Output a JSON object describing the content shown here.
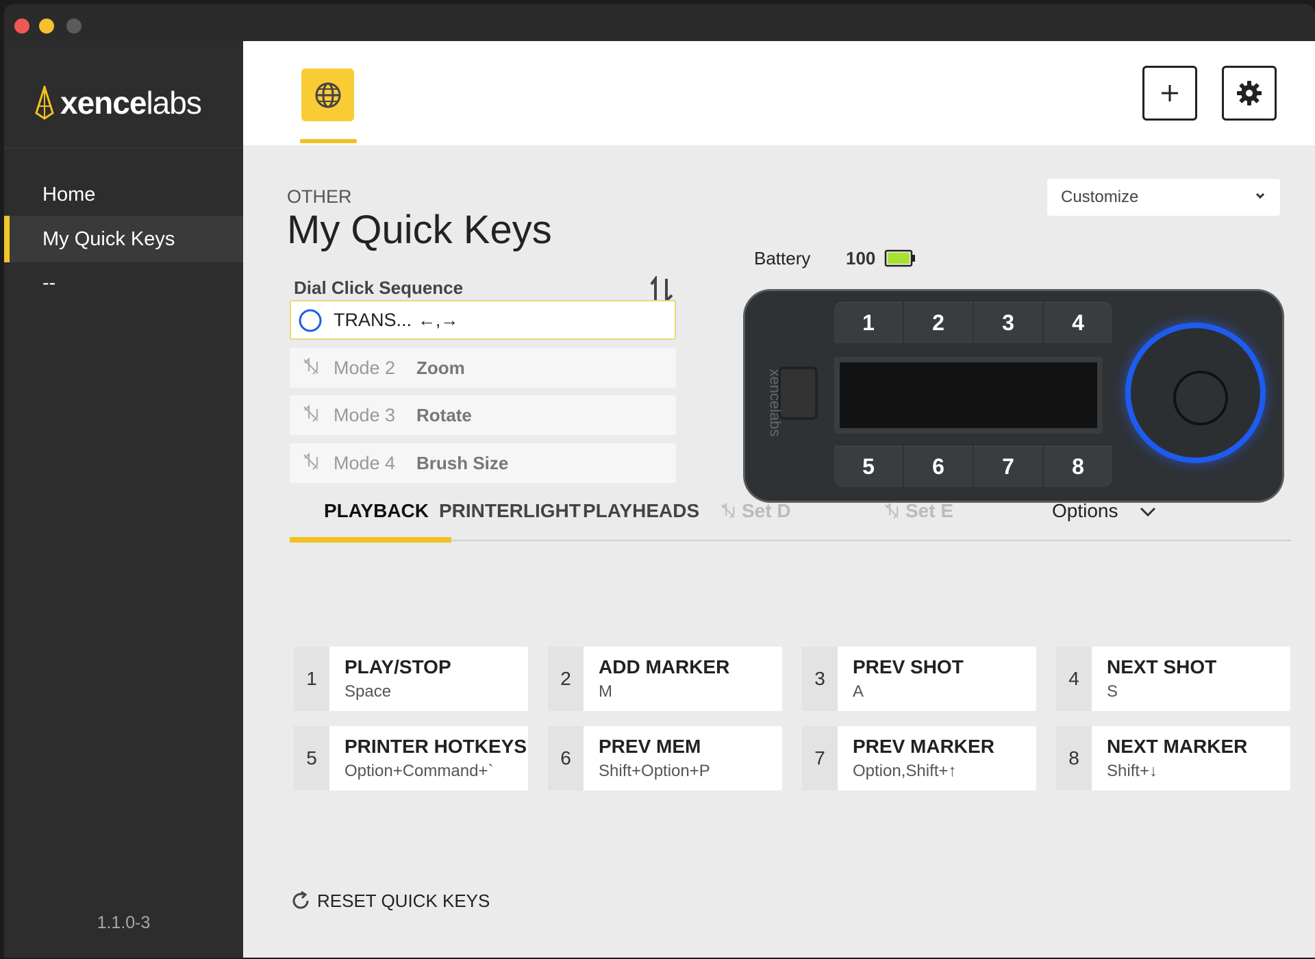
{
  "brand": {
    "name_bold": "xence",
    "name_light": "labs"
  },
  "sidebar": {
    "items": [
      {
        "label": "Home"
      },
      {
        "label": "My Quick Keys"
      },
      {
        "label": "--"
      }
    ],
    "version": "1.1.0-3"
  },
  "header": {
    "profile_icon": "globe-icon",
    "add_icon": "plus-icon",
    "settings_icon": "gear-icon"
  },
  "page": {
    "breadcrumb": "OTHER",
    "title": "My Quick Keys"
  },
  "customize": {
    "value": "Customize"
  },
  "battery": {
    "label": "Battery",
    "value": "100",
    "color": "#a6e22e"
  },
  "dial": {
    "label": "Dial Click Sequence",
    "modes": [
      {
        "name": "TRANS...",
        "value": "←,→"
      },
      {
        "name": "Mode 2",
        "value": "Zoom"
      },
      {
        "name": "Mode 3",
        "value": "Rotate"
      },
      {
        "name": "Mode 4",
        "value": "Brush Size"
      }
    ]
  },
  "device": {
    "keys": [
      "1",
      "2",
      "3",
      "4",
      "5",
      "6",
      "7",
      "8"
    ],
    "brand": "xencelabs",
    "ring_color": "#1e5cf0"
  },
  "tabs": {
    "items": [
      {
        "label": "PLAYBACK"
      },
      {
        "label": "PRINTERLIGHT"
      },
      {
        "label": "PLAYHEADS"
      },
      {
        "label": "Set D"
      },
      {
        "label": "Set E"
      }
    ],
    "options": "Options"
  },
  "keys": [
    {
      "num": "1",
      "title": "PLAY/STOP",
      "shortcut": "Space"
    },
    {
      "num": "2",
      "title": "ADD MARKER",
      "shortcut": "M"
    },
    {
      "num": "3",
      "title": "PREV SHOT",
      "shortcut": "A"
    },
    {
      "num": "4",
      "title": "NEXT SHOT",
      "shortcut": "S"
    },
    {
      "num": "5",
      "title": "PRINTER HOTKEYS",
      "shortcut": "Option+Command+`"
    },
    {
      "num": "6",
      "title": "PREV MEM",
      "shortcut": "Shift+Option+P"
    },
    {
      "num": "7",
      "title": "PREV MARKER",
      "shortcut": "Option,Shift+↑"
    },
    {
      "num": "8",
      "title": "NEXT MARKER",
      "shortcut": "Shift+↓"
    }
  ],
  "reset": {
    "label": "RESET QUICK KEYS"
  },
  "colors": {
    "accent": "#f3c11f",
    "sidebar": "#2d2d2d",
    "content": "#ebebeb"
  }
}
